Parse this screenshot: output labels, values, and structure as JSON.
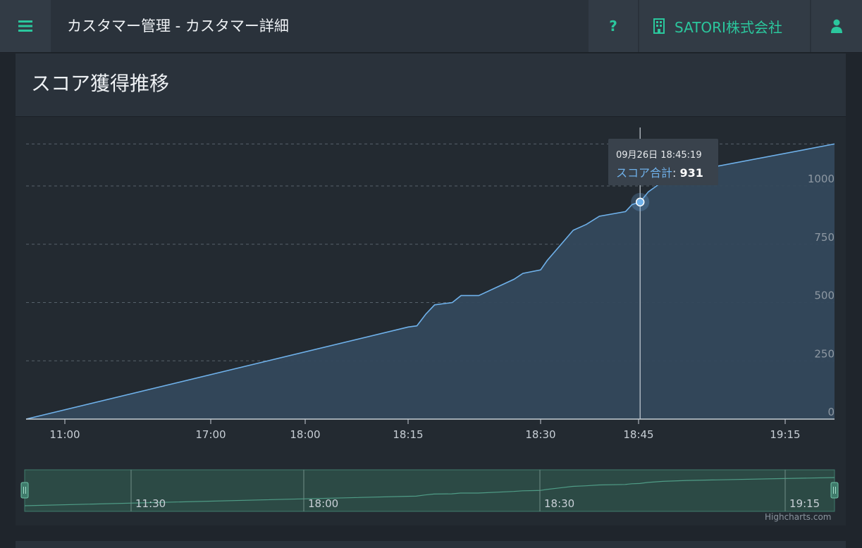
{
  "header": {
    "menu_icon": "hamburger-icon",
    "title": "カスタマー管理 - カスタマー詳細",
    "help_label": "?",
    "company_icon": "building-icon",
    "company_name": "SATORI株式会社",
    "user_icon": "user-icon"
  },
  "panel": {
    "title": "スコア獲得推移"
  },
  "colors": {
    "accent": "#2bc79d",
    "series_line": "#6fb1ea",
    "series_fill": "#34485c",
    "navigator": "#2e5a50"
  },
  "chart_data": {
    "type": "area",
    "title": "",
    "xlabel": "",
    "ylabel": "",
    "x_ticks": [
      "11:00",
      "17:00",
      "18:00",
      "18:15",
      "18:30",
      "18:45",
      "19:15"
    ],
    "y_ticks": [
      0,
      250,
      500,
      750,
      1000
    ],
    "ylim": [
      0,
      1180
    ],
    "grid": true,
    "series": [
      {
        "name": "スコア合計",
        "points": [
          [
            "10:55",
            0
          ],
          [
            "18:15",
            395
          ],
          [
            "18:16",
            400
          ],
          [
            "18:17",
            450
          ],
          [
            "18:18",
            490
          ],
          [
            "18:20",
            500
          ],
          [
            "18:21",
            530
          ],
          [
            "18:23",
            530
          ],
          [
            "18:27",
            600
          ],
          [
            "18:28",
            625
          ],
          [
            "18:30",
            640
          ],
          [
            "18:31",
            680
          ],
          [
            "18:33",
            745
          ],
          [
            "18:35",
            810
          ],
          [
            "18:37",
            835
          ],
          [
            "18:39",
            870
          ],
          [
            "18:43",
            890
          ],
          [
            "18:44",
            920
          ],
          [
            "18:45:19",
            931
          ],
          [
            "18:47",
            975
          ],
          [
            "18:50",
            1020
          ],
          [
            "18:55",
            1060
          ],
          [
            "19:20",
            1180
          ]
        ]
      }
    ],
    "tooltip": {
      "date": "09月26日 18:45:19",
      "series": "スコア合計",
      "colon": ":",
      "value": "931"
    },
    "navigator": {
      "labels": [
        "11:30",
        "18:00",
        "18:30",
        "19:15"
      ]
    },
    "credits": "Highcharts.com"
  }
}
